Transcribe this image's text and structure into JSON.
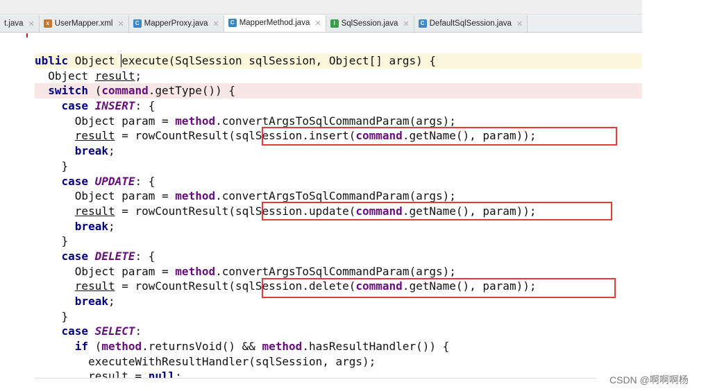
{
  "tabs": [
    {
      "label": "t.java",
      "icon": "java-class-icon",
      "active": false
    },
    {
      "label": "UserMapper.xml",
      "icon": "xml-file-icon",
      "active": false
    },
    {
      "label": "MapperProxy.java",
      "icon": "java-class-icon",
      "active": false
    },
    {
      "label": "MapperMethod.java",
      "icon": "java-class-icon",
      "active": true
    },
    {
      "label": "SqlSession.java",
      "icon": "java-interface-icon",
      "active": false
    },
    {
      "label": "DefaultSqlSession.java",
      "icon": "java-class-icon",
      "active": false
    }
  ],
  "code": {
    "l1": {
      "a": "ublic ",
      "b": "Object ",
      "c": "execute",
      "d": "(SqlSession sqlSession, Object[] args) {"
    },
    "l2": {
      "a": "Object ",
      "b": "result",
      "c": ";"
    },
    "l3": {
      "a": "switch",
      "b": " (",
      "c": "command",
      "d": ".getType()) {"
    },
    "l4": {
      "a": "case ",
      "b": "INSERT",
      "c": ": {"
    },
    "l5": {
      "a": "Object param = ",
      "b": "method",
      "c": ".convertArgsToSqlCommandParam(args);"
    },
    "l6": {
      "a": "result",
      "b": " = rowCountResult(sqlSession.insert(",
      "c": "command",
      "d": ".getName(), param));"
    },
    "l7": {
      "a": "break",
      "b": ";"
    },
    "l8": "}",
    "l9": {
      "a": "case ",
      "b": "UPDATE",
      "c": ": {"
    },
    "l10": {
      "a": "Object param = ",
      "b": "method",
      "c": ".convertArgsToSqlCommandParam(args);"
    },
    "l11": {
      "a": "result",
      "b": " = rowCountResult(sqlSession.update(",
      "c": "command",
      "d": ".getName(), param));"
    },
    "l12": {
      "a": "break",
      "b": ";"
    },
    "l13": "}",
    "l14": {
      "a": "case ",
      "b": "DELETE",
      "c": ": {"
    },
    "l15": {
      "a": "Object param = ",
      "b": "method",
      "c": ".convertArgsToSqlCommandParam(args);"
    },
    "l16": {
      "a": "result",
      "b": " = rowCountResult(sqlSession.delete(",
      "c": "command",
      "d": ".getName(), param));"
    },
    "l17": {
      "a": "break",
      "b": ";"
    },
    "l18": "}",
    "l19": {
      "a": "case ",
      "b": "SELECT",
      "c": ":"
    },
    "l20": {
      "a": "if",
      "b": " (",
      "c": "method",
      "d": ".returnsVoid() && ",
      "e": "method",
      "f": ".hasResultHandler()) {"
    },
    "l21": "executeWithResultHandler(sqlSession, args);",
    "l22": {
      "a": "result",
      "b": " = ",
      "c": "null",
      "d": ";"
    }
  },
  "watermark": "CSDN @啊啊啊杨",
  "colors": {
    "keyword": "#000080",
    "field": "#660e7a",
    "highlight_box": "#e33b3b"
  }
}
